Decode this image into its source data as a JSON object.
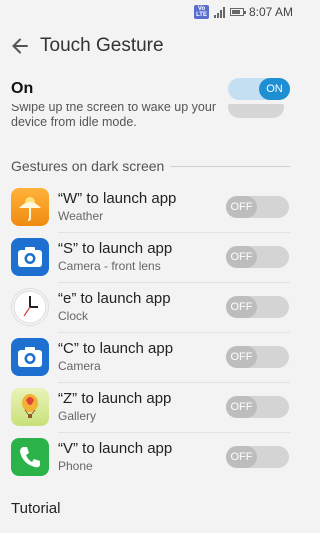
{
  "status_bar": {
    "network_label": "VoLTE",
    "time": "8:07 AM"
  },
  "app_bar": {
    "title": "Touch Gesture"
  },
  "master_switch": {
    "label": "On",
    "state": "ON"
  },
  "description": {
    "line1": "Swipe up the screen to wake up your",
    "line2": "device from idle mode."
  },
  "section_header": "Gestures on dark screen",
  "gestures": [
    {
      "title": "“W” to launch app",
      "subtitle": "Weather",
      "state": "OFF",
      "icon": "weather-icon"
    },
    {
      "title": "“S” to launch app",
      "subtitle": "Camera - front lens",
      "state": "OFF",
      "icon": "camera-icon"
    },
    {
      "title": "“e” to launch app",
      "subtitle": "Clock",
      "state": "OFF",
      "icon": "clock-icon"
    },
    {
      "title": "“C” to launch app",
      "subtitle": "Camera",
      "state": "OFF",
      "icon": "camera-icon"
    },
    {
      "title": "“Z” to launch app",
      "subtitle": "Gallery",
      "state": "OFF",
      "icon": "gallery-icon"
    },
    {
      "title": "“V” to launch app",
      "subtitle": "Phone",
      "state": "OFF",
      "icon": "phone-icon"
    }
  ],
  "tutorial_label": "Tutorial",
  "colors": {
    "accent": "#1e8fd3",
    "toggle_off": "#d4d4d4"
  }
}
